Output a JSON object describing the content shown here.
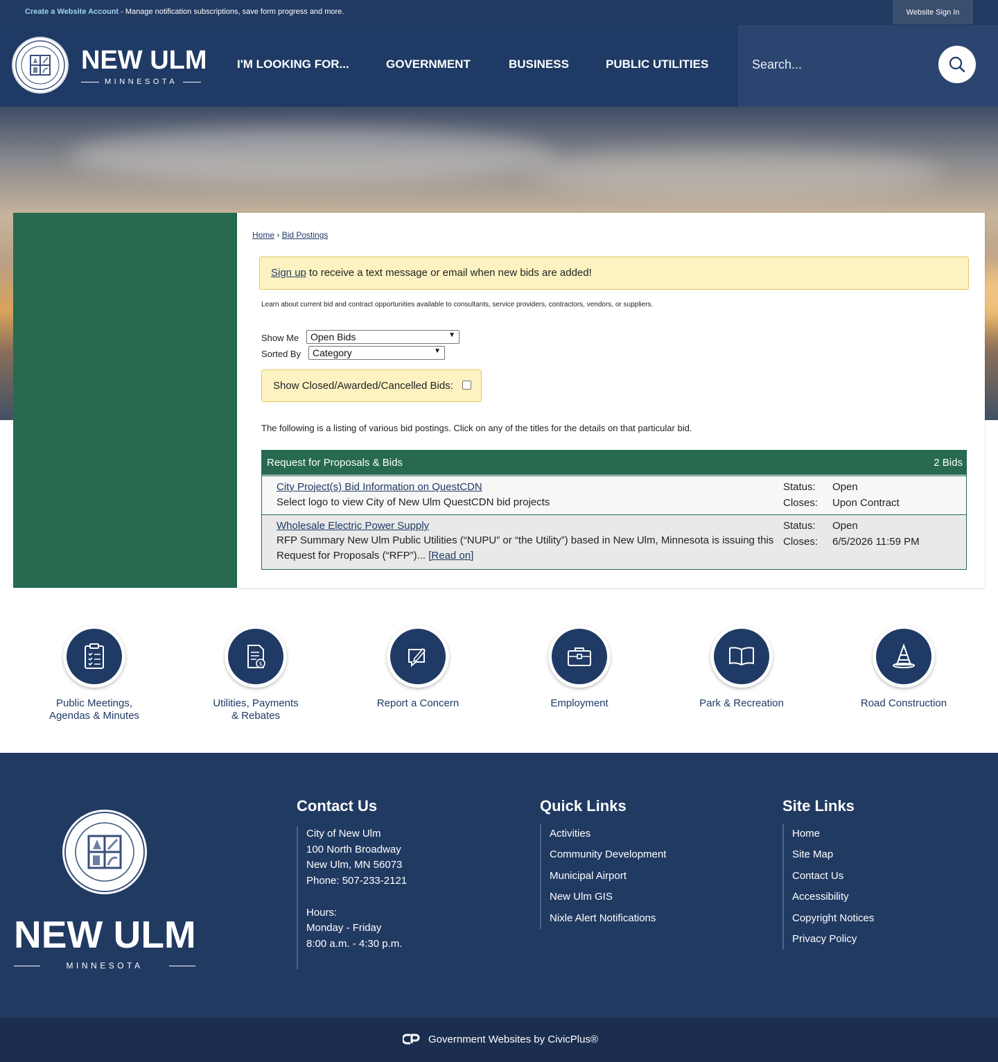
{
  "topbar": {
    "create_link": "Create a Website Account",
    "message": " - Manage notification subscriptions, save form progress and more.",
    "signin": "Website Sign In"
  },
  "header": {
    "brand_title": "NEW ULM",
    "brand_sub": "MINNESOTA",
    "nav": [
      "I'M LOOKING FOR...",
      "GOVERNMENT",
      "BUSINESS",
      "PUBLIC UTILITIES"
    ],
    "search_placeholder": "Search..."
  },
  "breadcrumb": {
    "home": "Home",
    "current": "Bid Postings",
    "sep": "›"
  },
  "alert": {
    "link": "Sign up",
    "text": " to receive a text message or email when new bids are added!"
  },
  "intro": "Learn about current bid and contract opportunities available to consultants, service providers, contractors, vendors, or suppliers.",
  "filters": {
    "show_me_label": "Show Me",
    "show_me_value": "Open Bids",
    "sorted_by_label": "Sorted By",
    "sorted_by_value": "Category",
    "closed_label": "Show Closed/Awarded/Cancelled Bids:",
    "closed_checked": false
  },
  "listing_text": "The following is a listing of various bid postings. Click on any of the titles for the details on that particular bid.",
  "bid_table": {
    "category": "Request for Proposals & Bids",
    "count": "2 Bids",
    "rows": [
      {
        "title": "City Project(s) Bid Information on QuestCDN",
        "desc": "Select logo to view City of New Ulm QuestCDN bid projects",
        "read_on": "",
        "status_label": "Status:",
        "status": "Open",
        "closes_label": "Closes:",
        "closes": "Upon Contract"
      },
      {
        "title": "Wholesale Electric Power Supply",
        "desc": "RFP Summary New Ulm Public Utilities (“NUPU” or “the Utility”) based in New Ulm, Minnesota is issuing this Request for Proposals (“RFP”)... ",
        "read_on": "[Read on]",
        "status_label": "Status:",
        "status": "Open",
        "closes_label": "Closes:",
        "closes": "6/5/2026 11:59 PM"
      }
    ]
  },
  "quick_links": [
    {
      "line1": "Public Meetings,",
      "line2": "Agendas & Minutes",
      "icon": "clipboard-checklist-icon"
    },
    {
      "line1": "Utilities, Payments",
      "line2": "& Rebates",
      "icon": "bill-dollar-icon"
    },
    {
      "line1": "Report a Concern",
      "line2": "",
      "icon": "pencil-note-icon"
    },
    {
      "line1": "Employment",
      "line2": "",
      "icon": "briefcase-icon"
    },
    {
      "line1": "Park & Recreation",
      "line2": "",
      "icon": "open-book-icon"
    },
    {
      "line1": "Road Construction",
      "line2": "",
      "icon": "traffic-cone-icon"
    }
  ],
  "footer": {
    "brand_title": "NEW ULM",
    "brand_sub": "MINNESOTA",
    "contact": {
      "heading": "Contact Us",
      "lines": [
        "City of New Ulm",
        "100 North Broadway",
        "New Ulm, MN 56073",
        "Phone: 507-233-2121",
        "",
        "Hours:",
        "Monday - Friday",
        "8:00 a.m. - 4:30 p.m."
      ]
    },
    "quick": {
      "heading": "Quick Links",
      "links": [
        "Activities",
        "Community Development",
        "Municipal Airport",
        "New Ulm GIS",
        "Nixle Alert Notifications"
      ]
    },
    "site": {
      "heading": "Site Links",
      "links": [
        "Home",
        "Site Map",
        "Contact Us",
        "Accessibility",
        "Copyright Notices",
        "Privacy Policy"
      ]
    },
    "credit": "Government Websites by CivicPlus®"
  },
  "colors": {
    "navy": "#1f3a64",
    "green": "#276a50",
    "yellow_bg": "#fdf3c2"
  }
}
